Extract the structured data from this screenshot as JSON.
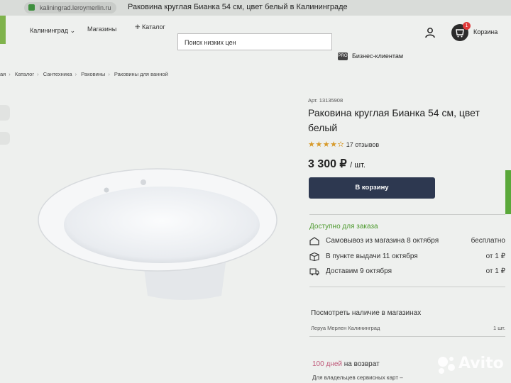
{
  "browser": {
    "url": "kaliningrad.leroymerlin.ru",
    "tab_title": "Раковина круглая Бианка 54 см, цвет белый в Калининграде"
  },
  "header": {
    "city": "Калининград",
    "stores_link": "Магазины",
    "catalog_button": "Каталог",
    "search_placeholder": "Поиск низких цен",
    "cart_label": "Корзина",
    "cart_count": "1",
    "pro_badge": "PRO",
    "business_link": "Бизнес-клиентам"
  },
  "breadcrumb": [
    "ая",
    "Каталог",
    "Сантехника",
    "Раковины",
    "Раковины для ванной"
  ],
  "product": {
    "article": "Арт. 13135908",
    "title": "Раковина круглая Бианка 54 см, цвет белый",
    "rating_stars": "★★★★✫",
    "reviews": "17 отзывов",
    "price": "3 300 ₽",
    "price_unit": "/ шт.",
    "buy_button": "В корзину"
  },
  "availability": {
    "status": "Доступно для заказа",
    "options": [
      {
        "icon": "store-icon",
        "label": "Самовывоз из магазина 8 октября",
        "value": "бесплатно"
      },
      {
        "icon": "box-icon",
        "label": "В пункте выдачи 11 октября",
        "value": "от 1 ₽"
      },
      {
        "icon": "truck-icon",
        "label": "Доставим 9 октября",
        "value": "от 1 ₽"
      }
    ]
  },
  "stores": {
    "title": "Посмотреть наличие в магазинах",
    "store_name": "Леруа Мерлен Калининград",
    "store_qty": "1 шт."
  },
  "returns": {
    "days": "100 дней",
    "text": "на возврат",
    "owners_text": "Для владельцев сервисных карт –"
  },
  "watermark": "Avito",
  "colors": {
    "accent_dark": "#2d3850",
    "available_green": "#4d9a2e",
    "stars": "#d79a2a",
    "cart_badge": "#e03a3a"
  }
}
